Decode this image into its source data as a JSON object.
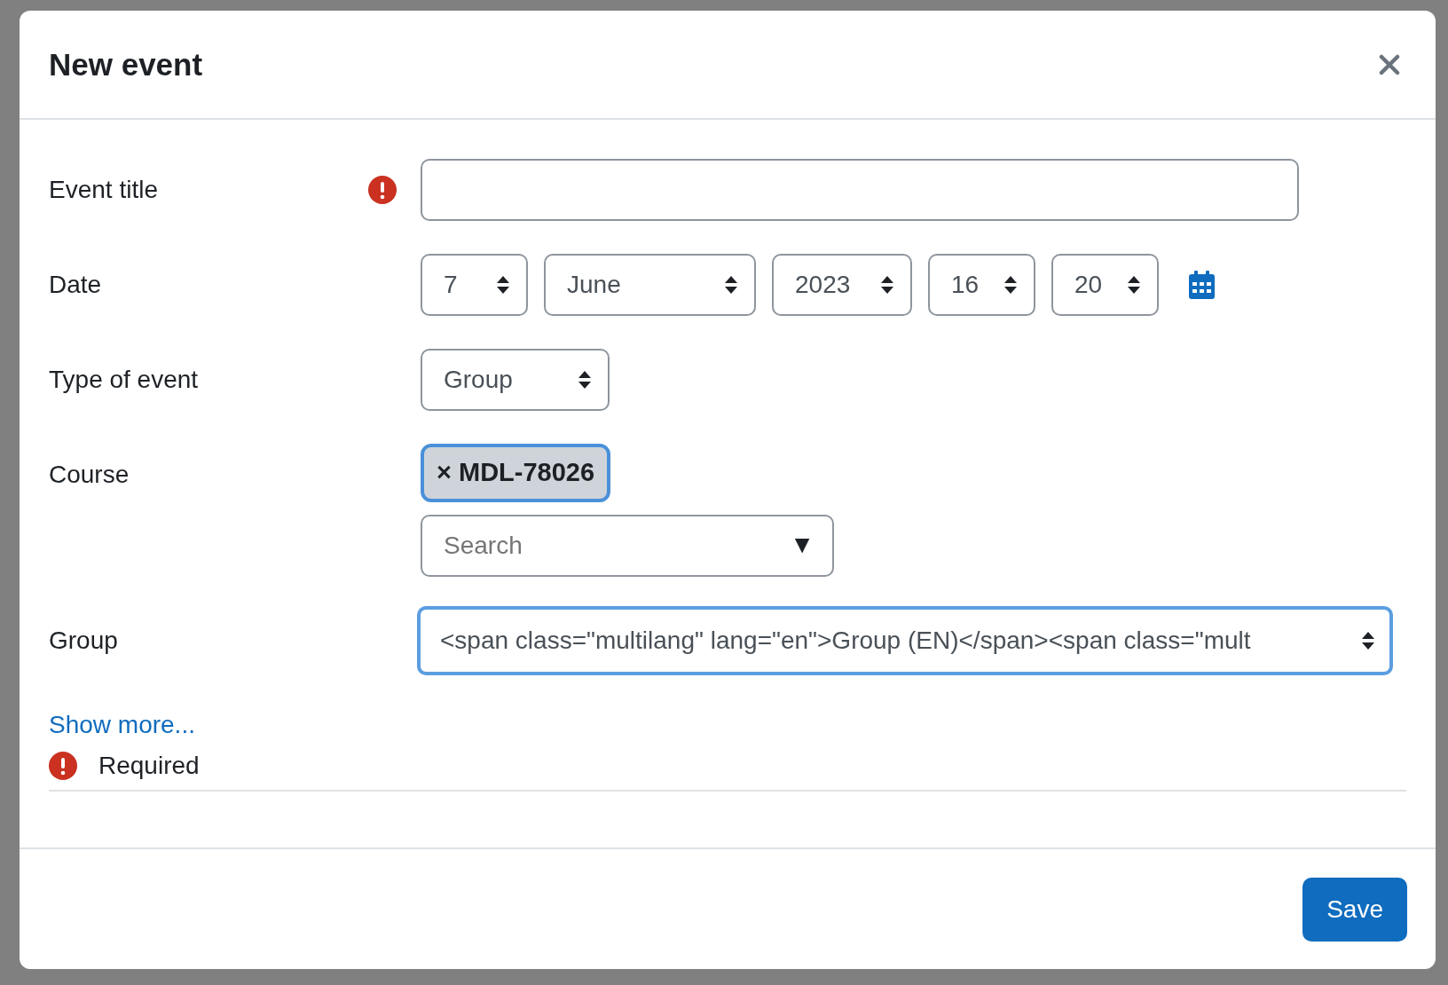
{
  "modal": {
    "title": "New event"
  },
  "fields": [
    {
      "kind": "text",
      "label": "Event title",
      "required": true,
      "focused": false
    },
    {
      "kind": "date",
      "label": "Date",
      "required": false,
      "selects": [
        "7",
        "June",
        "2023",
        "16",
        "20"
      ]
    },
    {
      "kind": "select",
      "label": "Type of event",
      "required": false,
      "value": "Group",
      "focused": false
    },
    {
      "kind": "autocomplete",
      "label": "Course",
      "required": false,
      "chips": [
        {
          "remove": "×",
          "text": "MDL-78026",
          "selected": true
        }
      ],
      "placeholder": "Search",
      "toggle": "▼"
    },
    {
      "kind": "select",
      "label": "Group",
      "required": false,
      "value": "<span class=\"multilang\" lang=\"en\">Group (EN)</span><span class=\"mult",
      "focused": true
    }
  ],
  "show_more": "Show more...",
  "required_note": "Required",
  "buttons": [
    {
      "label": "Save"
    }
  ]
}
